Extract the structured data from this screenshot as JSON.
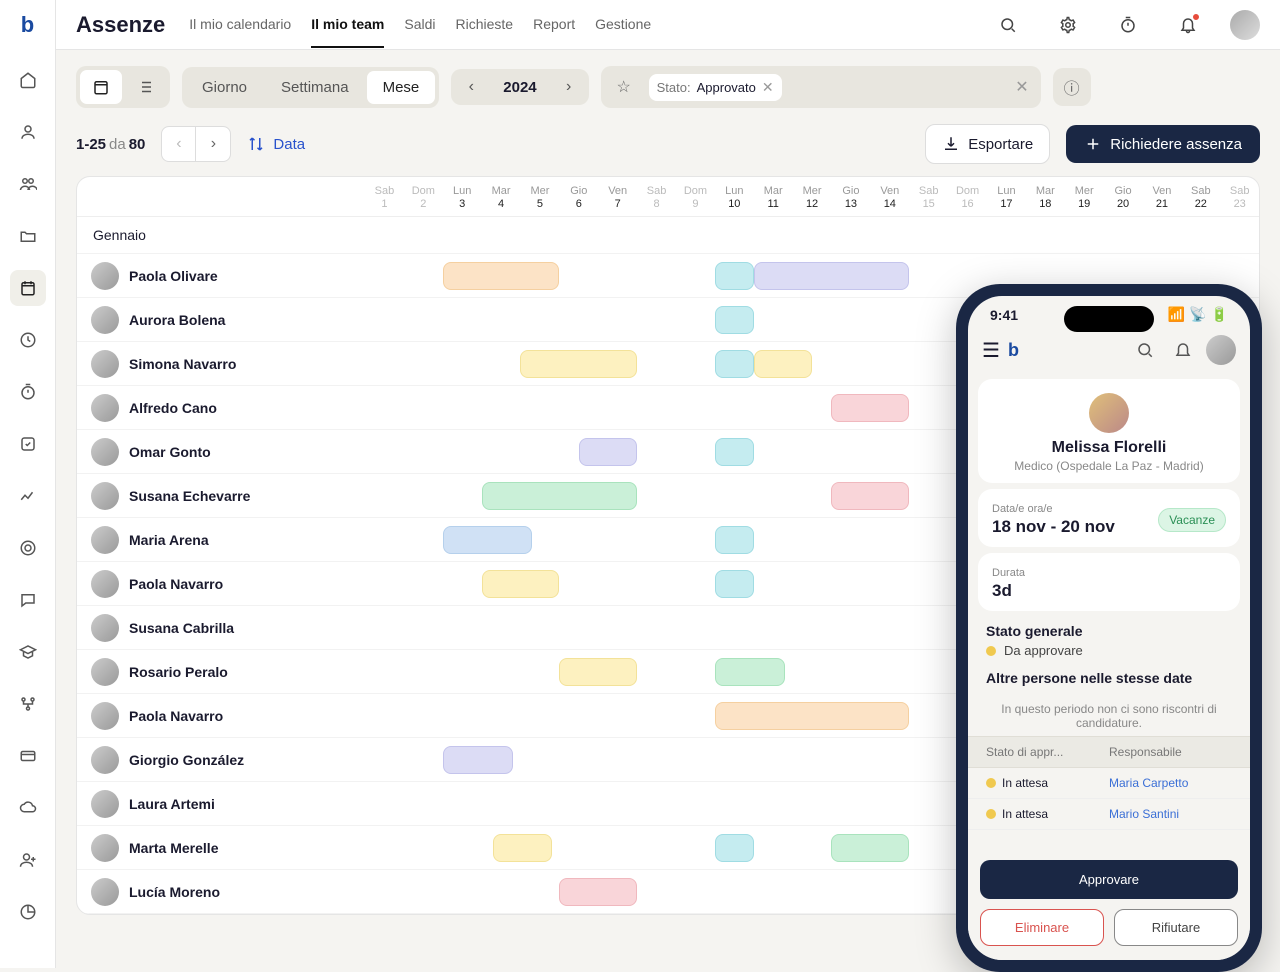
{
  "app": {
    "title": "Assenze",
    "logo": "b"
  },
  "tabs": [
    {
      "label": "Il mio calendario",
      "active": false
    },
    {
      "label": "Il mio team",
      "active": true
    },
    {
      "label": "Saldi",
      "active": false
    },
    {
      "label": "Richieste",
      "active": false
    },
    {
      "label": "Report",
      "active": false
    },
    {
      "label": "Gestione",
      "active": false
    }
  ],
  "view_segments": [
    {
      "label": "Giorno",
      "active": false
    },
    {
      "label": "Settimana",
      "active": false
    },
    {
      "label": "Mese",
      "active": true
    }
  ],
  "year": "2024",
  "filter": {
    "label": "Stato:",
    "chip": "Approvato"
  },
  "range": {
    "from": "1-25",
    "sep": "da",
    "total": "80"
  },
  "sort_label": "Data",
  "export_label": "Esportare",
  "request_label": "Richiedere assenza",
  "month_row": "Gennaio",
  "days": [
    {
      "dow": "Sab",
      "num": "1",
      "wknd": true
    },
    {
      "dow": "Dom",
      "num": "2",
      "wknd": true
    },
    {
      "dow": "Lun",
      "num": "3"
    },
    {
      "dow": "Mar",
      "num": "4"
    },
    {
      "dow": "Mer",
      "num": "5"
    },
    {
      "dow": "Gio",
      "num": "6"
    },
    {
      "dow": "Ven",
      "num": "7"
    },
    {
      "dow": "Sab",
      "num": "8",
      "wknd": true
    },
    {
      "dow": "Dom",
      "num": "9",
      "wknd": true
    },
    {
      "dow": "Lun",
      "num": "10"
    },
    {
      "dow": "Mar",
      "num": "11"
    },
    {
      "dow": "Mer",
      "num": "12"
    },
    {
      "dow": "Gio",
      "num": "13"
    },
    {
      "dow": "Ven",
      "num": "14"
    },
    {
      "dow": "Sab",
      "num": "15",
      "wknd": true
    },
    {
      "dow": "Dom",
      "num": "16",
      "wknd": true
    },
    {
      "dow": "Lun",
      "num": "17"
    },
    {
      "dow": "Mar",
      "num": "18"
    },
    {
      "dow": "Mer",
      "num": "19"
    },
    {
      "dow": "Gio",
      "num": "20"
    },
    {
      "dow": "Ven",
      "num": "21"
    },
    {
      "dow": "Sab",
      "num": "22"
    },
    {
      "dow": "Sab",
      "num": "23",
      "wknd": true
    }
  ],
  "people": [
    {
      "name": "Paola Olivare",
      "bars": [
        {
          "start": 2,
          "end": 5,
          "cls": "bar-orange"
        },
        {
          "start": 9,
          "end": 10,
          "cls": "bar-cyan"
        },
        {
          "start": 10,
          "end": 14,
          "cls": "bar-purple"
        }
      ]
    },
    {
      "name": "Aurora Bolena",
      "bars": [
        {
          "start": 9,
          "end": 10,
          "cls": "bar-cyan"
        }
      ]
    },
    {
      "name": "Simona Navarro",
      "bars": [
        {
          "start": 4,
          "end": 7,
          "cls": "bar-yellow"
        },
        {
          "start": 9,
          "end": 10,
          "cls": "bar-cyan"
        },
        {
          "start": 10,
          "end": 11.5,
          "cls": "bar-yellow"
        }
      ]
    },
    {
      "name": "Alfredo Cano",
      "bars": [
        {
          "start": 12,
          "end": 14,
          "cls": "bar-pink"
        }
      ]
    },
    {
      "name": "Omar Gonto",
      "bars": [
        {
          "start": 5.5,
          "end": 7,
          "cls": "bar-purple"
        },
        {
          "start": 9,
          "end": 10,
          "cls": "bar-cyan"
        }
      ]
    },
    {
      "name": "Susana Echevarre",
      "bars": [
        {
          "start": 3,
          "end": 7,
          "cls": "bar-green"
        },
        {
          "start": 12,
          "end": 14,
          "cls": "bar-pink"
        }
      ]
    },
    {
      "name": "Maria Arena",
      "bars": [
        {
          "start": 2,
          "end": 4.3,
          "cls": "bar-blue"
        },
        {
          "start": 9,
          "end": 10,
          "cls": "bar-cyan"
        }
      ]
    },
    {
      "name": "Paola Navarro",
      "bars": [
        {
          "start": 3,
          "end": 5,
          "cls": "bar-yellow"
        },
        {
          "start": 9,
          "end": 10,
          "cls": "bar-cyan"
        }
      ]
    },
    {
      "name": "Susana Cabrilla",
      "bars": []
    },
    {
      "name": "Rosario Peralo",
      "bars": [
        {
          "start": 5,
          "end": 7,
          "cls": "bar-yellow"
        },
        {
          "start": 9,
          "end": 10.8,
          "cls": "bar-green"
        }
      ]
    },
    {
      "name": "Paola Navarro",
      "bars": [
        {
          "start": 9,
          "end": 14,
          "cls": "bar-orange"
        }
      ]
    },
    {
      "name": "Giorgio González",
      "bars": [
        {
          "start": 2,
          "end": 3.8,
          "cls": "bar-purple"
        }
      ]
    },
    {
      "name": "Laura Artemi",
      "bars": []
    },
    {
      "name": "Marta Merelle",
      "bars": [
        {
          "start": 3.3,
          "end": 4.8,
          "cls": "bar-yellow"
        },
        {
          "start": 9,
          "end": 10,
          "cls": "bar-cyan"
        },
        {
          "start": 12,
          "end": 14,
          "cls": "bar-green"
        }
      ]
    },
    {
      "name": "Lucía Moreno",
      "bars": [
        {
          "start": 5,
          "end": 7,
          "cls": "bar-pink"
        }
      ]
    }
  ],
  "phone": {
    "time": "9:41",
    "name": "Melissa Florelli",
    "role": "Medico (Ospedale La Paz - Madrid)",
    "date_label": "Data/e ora/e",
    "date_value": "18 nov - 20 nov",
    "badge": "Vacanze",
    "dur_label": "Durata",
    "dur_value": "3d",
    "status_title": "Stato generale",
    "status_value": "Da approvare",
    "others_title": "Altre persone nelle stesse date",
    "others_msg": "In questo periodo non ci sono riscontri di candidature.",
    "t_col1": "Stato di appr...",
    "t_col2": "Responsabile",
    "rows": [
      {
        "status": "In attesa",
        "manager": "Maria Carpetto"
      },
      {
        "status": "In attesa",
        "manager": "Mario Santini"
      }
    ],
    "approve": "Approvare",
    "delete": "Eliminare",
    "reject": "Rifiutare"
  }
}
